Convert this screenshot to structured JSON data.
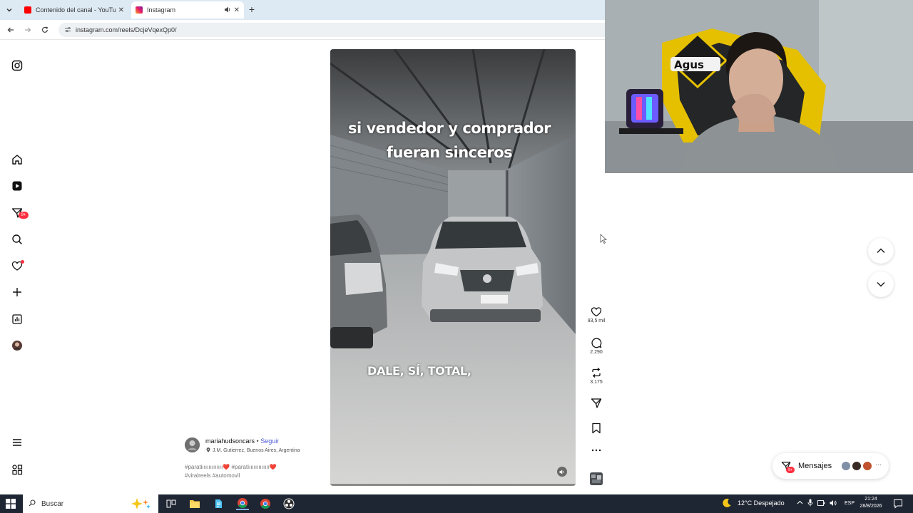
{
  "browser": {
    "tabs": [
      {
        "title": "Contenido del canal - YouTube",
        "favicon": "youtube-icon",
        "active": false
      },
      {
        "title": "Instagram",
        "favicon": "instagram-icon",
        "active": true
      }
    ],
    "url": "instagram.com/reels/DcjeVqexQp0/"
  },
  "sidebar": {
    "messages_badge": "9+"
  },
  "reel": {
    "caption_top_line1": "si vendedor y comprador",
    "caption_top_line2": "fueran sinceros",
    "caption_bottom": "DALE, SÍ, TOTAL,",
    "author": {
      "username": "mariahudsoncars",
      "separator": " • ",
      "follow_label": "Seguir",
      "location": "J.M. Gutierrez, Buenos Aires, Argentina"
    },
    "hashtags_line1": "#paratiııııııııııııı❤️ #paratiııııııııııııı❤️",
    "hashtags_line2": "#viralreels #automovil",
    "likes": "93,5 mil",
    "comments": "2.290",
    "reposts": "3.175"
  },
  "messages": {
    "label": "Mensajes",
    "badge": "9+"
  },
  "taskbar": {
    "search_placeholder": "Buscar",
    "weather": "12°C  Despejado",
    "lang": "ESP",
    "time": "21:24",
    "date": "28/8/2026"
  },
  "colors": {
    "tabbar_bg": "#dde9f3",
    "taskbar_bg": "#1f2633",
    "ig_notification_red": "#ff3040",
    "follow_link": "#4f5bd5"
  }
}
